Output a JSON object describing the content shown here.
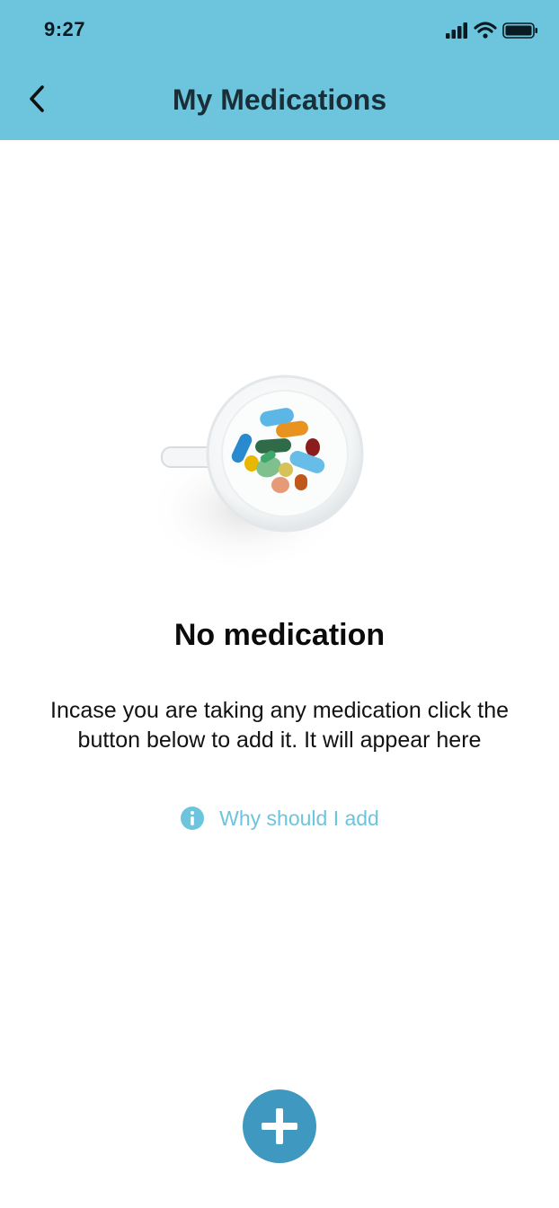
{
  "status_bar": {
    "time": "9:27",
    "icons": [
      "cellular-signal-icon",
      "wifi-icon",
      "battery-icon"
    ]
  },
  "header": {
    "back_icon": "chevron-left-icon",
    "title": "My Medications"
  },
  "empty_state": {
    "illustration": "pill-cup-illustration",
    "title": "No medication",
    "description": "Incase you are taking any medication click the button below to add it. It will appear here",
    "info_link": {
      "icon": "info-icon",
      "label": "Why should I add"
    }
  },
  "fab": {
    "icon": "plus-icon"
  },
  "colors": {
    "header_bg": "#6cc4dd",
    "link": "#6cc4dd",
    "fab_bg": "#3f98bf",
    "title_text": "#1a2e38"
  }
}
